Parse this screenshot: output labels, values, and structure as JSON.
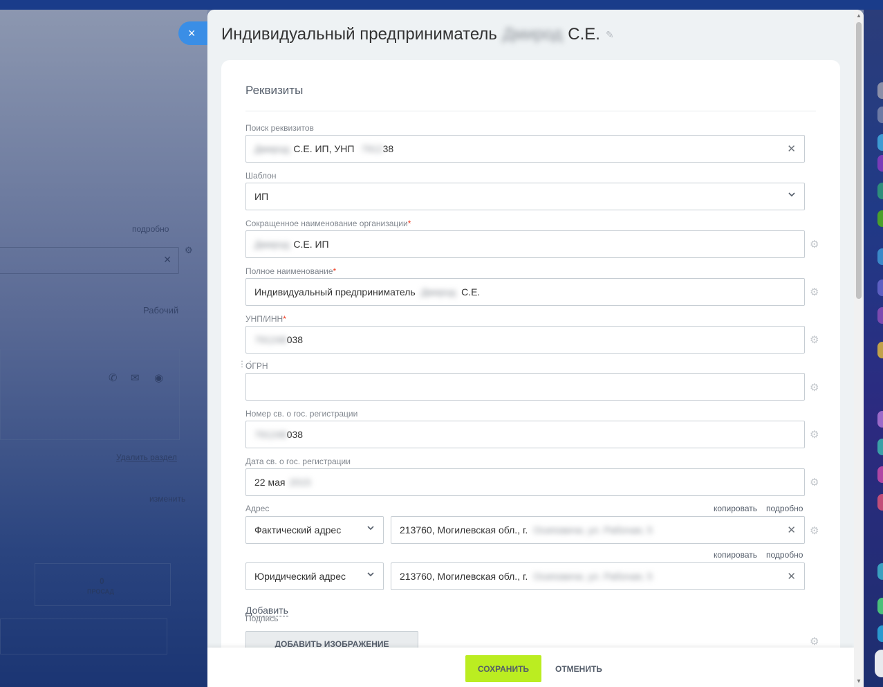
{
  "background": {
    "detail_link": "подробно",
    "work_label": "Рабочий",
    "delete_section": "Удалить раздел",
    "change": "изменить",
    "count": "0",
    "overdue": "ПРОСАД"
  },
  "panel": {
    "close_icon": "×",
    "title_prefix": "Индивидуальный предприниматель",
    "title_blurred": "Дмирод",
    "title_suffix": "С.Е.",
    "edit_icon": "✎"
  },
  "requisites": {
    "section_title": "Реквизиты",
    "search": {
      "label": "Поиск реквизитов",
      "value_blurred": "Дмирод",
      "value_visible": "С.Е. ИП, УНП",
      "value_blurred2": "7912",
      "value_end": "38"
    },
    "template": {
      "label": "Шаблон",
      "value": "ИП"
    },
    "short_name": {
      "label": "Сокращенное наименование организации",
      "value_blurred": "Дмирод",
      "value": "С.Е. ИП"
    },
    "full_name": {
      "label": "Полное наименование",
      "value": "Индивидуальный предприниматель",
      "value_blurred": "Дмирод",
      "value_end": "С.Е."
    },
    "unp": {
      "label": "УНП/ИНН",
      "value_blurred": "791248",
      "value_end": "038"
    },
    "ogrn": {
      "label": "ОГРН",
      "value": ""
    },
    "reg_number": {
      "label": "Номер св. о гос. регистрации",
      "value_blurred": "791248",
      "value_end": "038"
    },
    "reg_date": {
      "label": "Дата св. о гос. регистрации",
      "value": "22 мая",
      "value_blurred": "2015"
    },
    "address": {
      "label": "Адрес",
      "copy": "копировать",
      "detail": "подробно",
      "items": [
        {
          "type": "Фактический адрес",
          "value": "213760, Могилевская обл., г.",
          "value_blurred": "Осиповичи, ул. Рабочая, 5"
        },
        {
          "type": "Юридический адрес",
          "value": "213760, Могилевская обл., г.",
          "value_blurred": "Осиповичи, ул. Рабочая, 5"
        }
      ]
    },
    "add_link": "Добавить",
    "signature": {
      "label": "Подпись",
      "add_image": "ДОБАВИТЬ ИЗОБРАЖЕНИЕ"
    }
  },
  "footer": {
    "save": "СОХРАНИТЬ",
    "cancel": "ОТМЕНИТЬ"
  },
  "icons": {
    "clear": "✕",
    "chevron": "⌄",
    "gear": "⚙"
  }
}
